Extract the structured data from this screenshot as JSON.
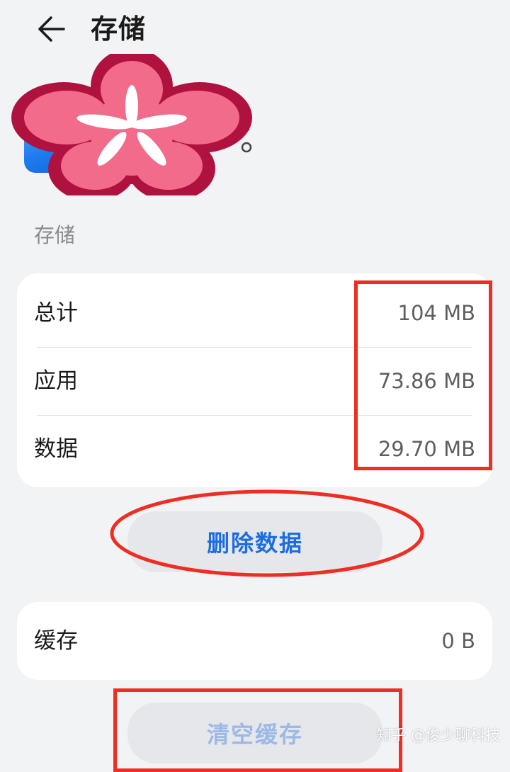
{
  "header": {
    "back_icon": "arrow-left-icon",
    "title": "存储"
  },
  "section": {
    "label": "存储"
  },
  "storage": {
    "rows": [
      {
        "label": "总计",
        "value": "104 MB"
      },
      {
        "label": "应用",
        "value": "73.86 MB"
      },
      {
        "label": "数据",
        "value": "29.70 MB"
      }
    ]
  },
  "buttons": {
    "delete_data": "删除数据",
    "clear_cache": "清空缓存"
  },
  "cache": {
    "label": "缓存",
    "value": "0 B"
  },
  "watermark": "知乎 @俊少聊科技",
  "colors": {
    "accent": "#1d6de0",
    "accent_disabled": "#9cb8e6",
    "annotation_red": "#ef2d22",
    "sticker_outer": "#b0123f",
    "sticker_inner": "#f26b8a"
  }
}
